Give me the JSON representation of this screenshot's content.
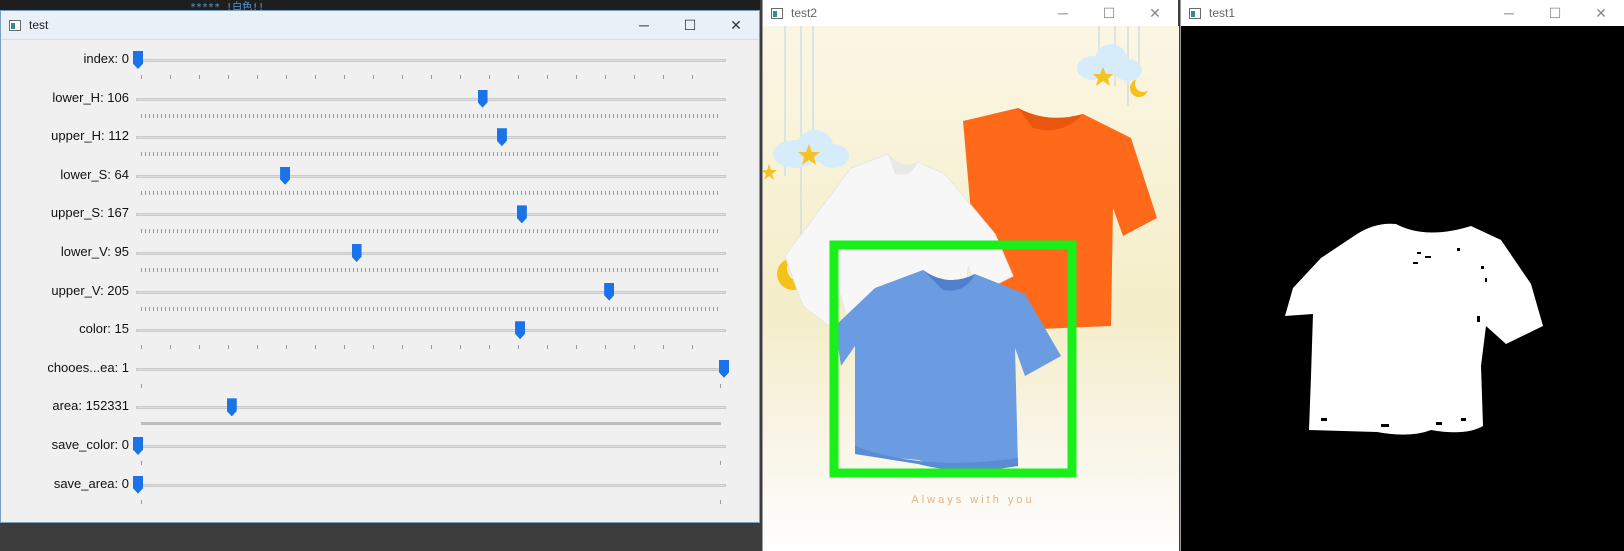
{
  "editor_strip": {
    "text": "*****  !白色!!"
  },
  "windows": {
    "controls": {
      "title": "test",
      "minimize": "─",
      "maximize": "☐",
      "close": "✕"
    },
    "preview": {
      "title": "test2",
      "tagline": "Always with you",
      "minimize": "─",
      "maximize": "☐",
      "close": "✕"
    },
    "mask": {
      "title": "test1",
      "minimize": "─",
      "maximize": "☐",
      "close": "✕"
    }
  },
  "trackbars": [
    {
      "label": "index: 0",
      "fraction": 0.0,
      "ticks": "sparse"
    },
    {
      "label": "lower_H: 106",
      "fraction": 0.588,
      "ticks": "dense"
    },
    {
      "label": "upper_H: 112",
      "fraction": 0.621,
      "ticks": "dense"
    },
    {
      "label": "lower_S: 64",
      "fraction": 0.251,
      "ticks": "dense"
    },
    {
      "label": "upper_S: 167",
      "fraction": 0.655,
      "ticks": "dense"
    },
    {
      "label": "lower_V: 95",
      "fraction": 0.373,
      "ticks": "dense"
    },
    {
      "label": "upper_V: 205",
      "fraction": 0.804,
      "ticks": "dense"
    },
    {
      "label": "color: 15",
      "fraction": 0.652,
      "ticks": "sparse"
    },
    {
      "label": "chooes...ea: 1",
      "fraction": 1.0,
      "ticks": "ends"
    },
    {
      "label": "area: 152331",
      "fraction": 0.16,
      "ticks": "solid"
    },
    {
      "label": "save_color: 0",
      "fraction": 0.0,
      "ticks": "ends"
    },
    {
      "label": "save_area: 0",
      "fraction": 0.0,
      "ticks": "ends"
    }
  ],
  "colors": {
    "thumb": "#1a73e8",
    "detection_box": "#19f019",
    "blue_shirt": "#6b9be0",
    "orange_shirt": "#ff6a1a",
    "white_shirt": "#f7f7f7"
  }
}
